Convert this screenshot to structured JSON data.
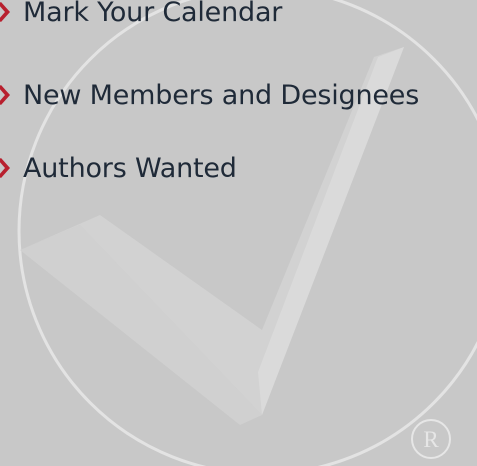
{
  "menu": {
    "items": [
      {
        "label": "Mark Your Calendar",
        "icon": "red-chevron-right-icon"
      },
      {
        "label": "New Members and Designees",
        "icon": "red-chevron-right-icon"
      },
      {
        "label": "Authors Wanted",
        "icon": "red-chevron-right-icon"
      }
    ]
  },
  "watermark": {
    "icon": "checkmark-circle-logo",
    "registered_symbol": "R"
  },
  "colors": {
    "background": "#c8c8c8",
    "text": "#1f2a38",
    "accent": "#b8202e",
    "watermark": "#e2e2e2"
  }
}
